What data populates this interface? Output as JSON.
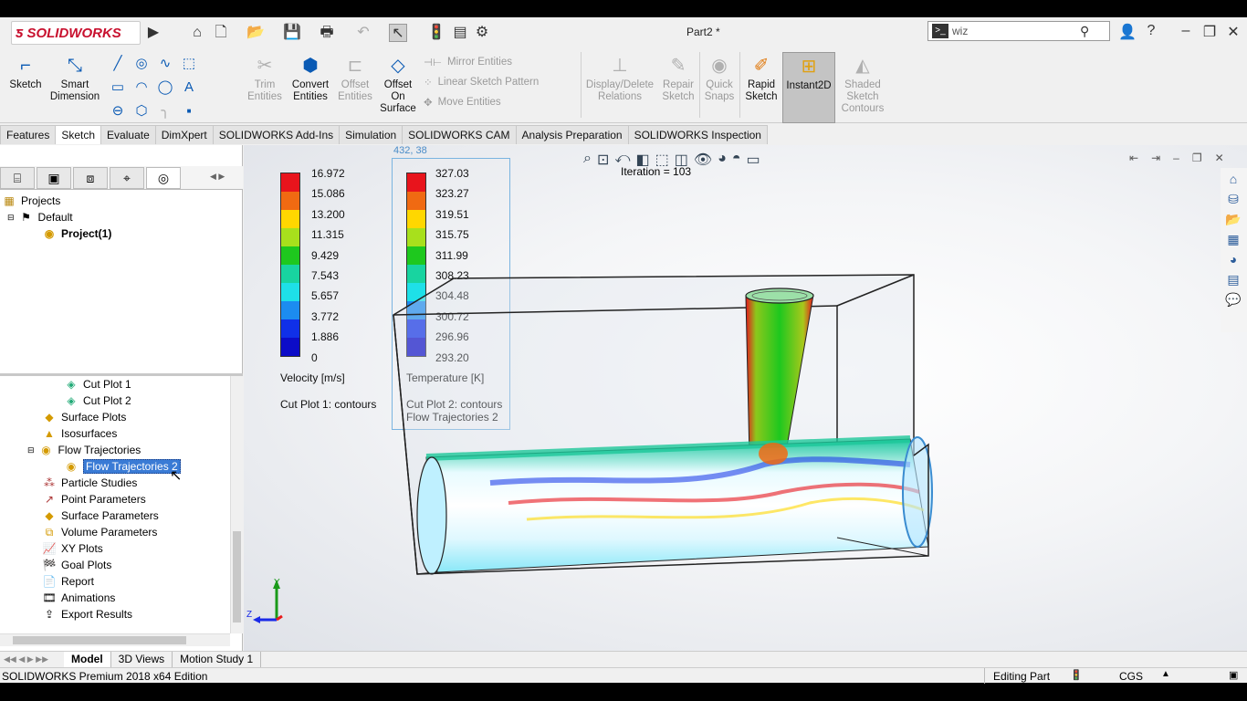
{
  "app": {
    "brand": "SOLIDWORKS",
    "document_title": "Part2 *"
  },
  "search": {
    "value": "wiz"
  },
  "command_manager": {
    "sketch": "Sketch",
    "smart_dimension": [
      "Smart",
      "Dimension"
    ],
    "trim_entities": [
      "Trim",
      "Entities"
    ],
    "convert_entities": [
      "Convert",
      "Entities"
    ],
    "offset_entities": [
      "Offset",
      "Entities"
    ],
    "offset_on_surface": [
      "Offset",
      "On",
      "Surface"
    ],
    "mirror_entities": "Mirror Entities",
    "linear_sketch_pattern": "Linear Sketch Pattern",
    "move_entities": "Move Entities",
    "display_delete_relations": [
      "Display/Delete",
      "Relations"
    ],
    "repair_sketch": [
      "Repair",
      "Sketch"
    ],
    "quick_snaps": [
      "Quick",
      "Snaps"
    ],
    "rapid_sketch": [
      "Rapid",
      "Sketch"
    ],
    "instant2d": "Instant2D",
    "shaded_sketch_contours": [
      "Shaded",
      "Sketch",
      "Contours"
    ]
  },
  "tabs": [
    "Features",
    "Sketch",
    "Evaluate",
    "DimXpert",
    "SOLIDWORKS Add-Ins",
    "Simulation",
    "SOLIDWORKS CAM",
    "Analysis Preparation",
    "SOLIDWORKS Inspection"
  ],
  "active_tab": "Sketch",
  "tree_top": {
    "projects": "Projects",
    "default": "Default",
    "project": "Project(1)"
  },
  "tree_bottom": [
    "Cut Plot 1",
    "Cut Plot 2",
    "Surface Plots",
    "Isosurfaces",
    "Flow Trajectories",
    "Flow Trajectories 2",
    "Particle Studies",
    "Point Parameters",
    "Surface Parameters",
    "Volume Parameters",
    "XY Plots",
    "Goal Plots",
    "Report",
    "Animations",
    "Export Results"
  ],
  "selected_tree_item": "Flow Trajectories 2",
  "bottom_tabs": [
    "Model",
    "3D Views",
    "Motion Study 1"
  ],
  "status": {
    "edition": "SOLIDWORKS Premium 2018 x64 Edition",
    "mode": "Editing Part",
    "units": "CGS"
  },
  "viewport": {
    "iteration": "Iteration = 103",
    "coord_readout": "432, 38",
    "legend_velocity": {
      "values": [
        "16.972",
        "15.086",
        "13.200",
        "11.315",
        "9.429",
        "7.543",
        "5.657",
        "3.772",
        "1.886",
        "0"
      ],
      "label": "Velocity [m/s]",
      "caption": "Cut Plot 1: contours"
    },
    "legend_temperature": {
      "values": [
        "327.03",
        "323.27",
        "319.51",
        "315.75",
        "311.99",
        "308.23",
        "304.48",
        "300.72",
        "296.96",
        "293.20"
      ],
      "label": "Temperature [K]",
      "caption1": "Cut Plot 2: contours",
      "caption2": "Flow Trajectories 2"
    },
    "legend_colors": [
      "#e8141c",
      "#f06a12",
      "#ffd700",
      "#a8e01c",
      "#1ec81e",
      "#18d4a0",
      "#1ee0e8",
      "#1c8cf0",
      "#1030e8",
      "#0c0cc8"
    ],
    "triad": {
      "y": "Y",
      "z": "Z"
    }
  }
}
